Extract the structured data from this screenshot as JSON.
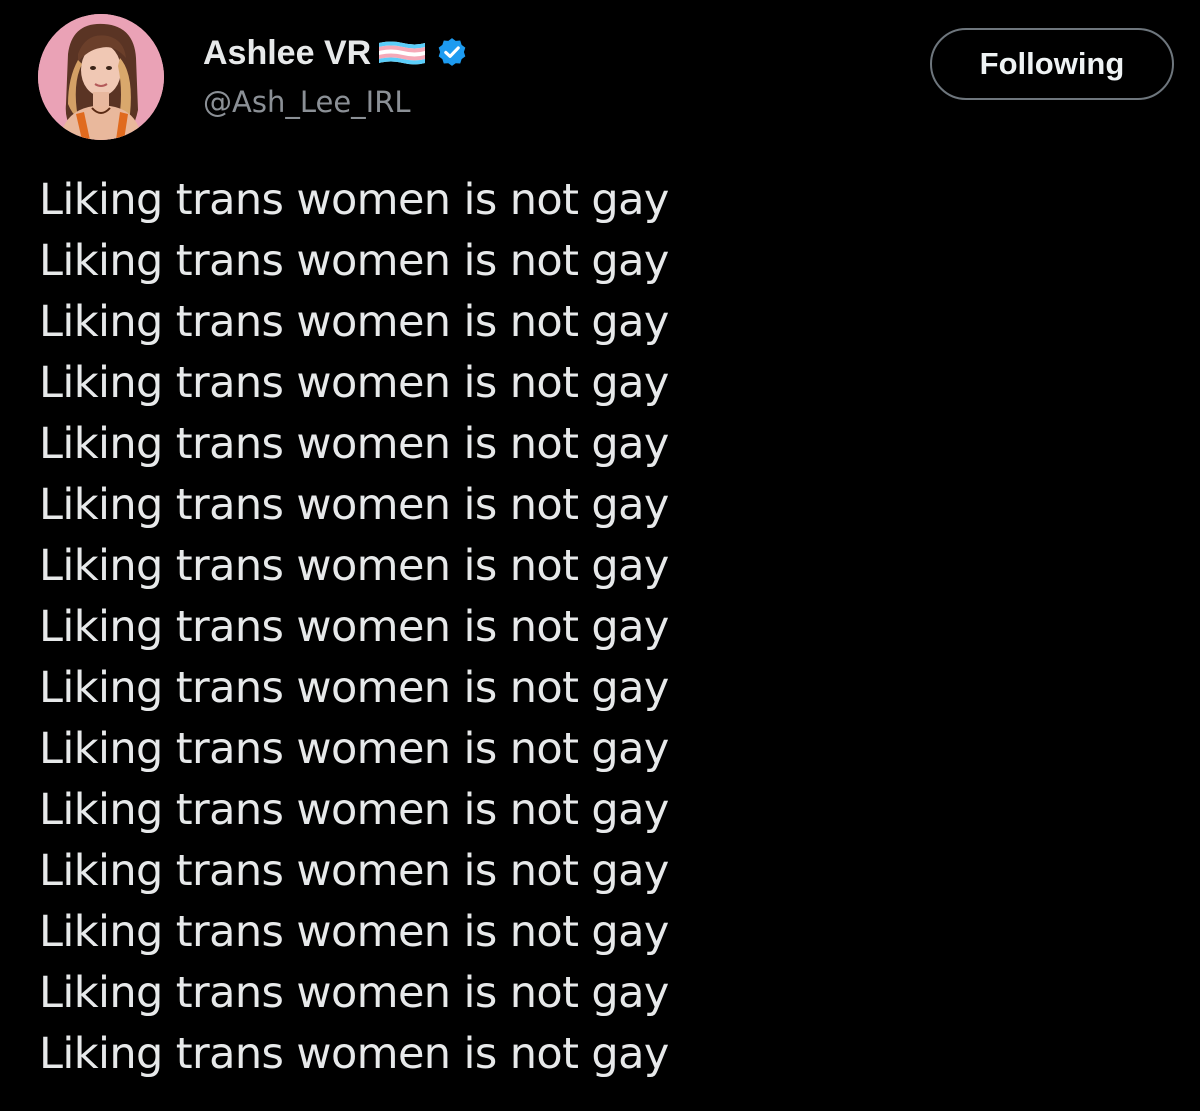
{
  "author": {
    "display_name": "Ashlee VR",
    "handle": "@Ash_Lee_IRL",
    "flag_icon": "transgender-flag-icon",
    "verified_icon": "verified-badge-icon",
    "verified_color": "#1d9bf0"
  },
  "follow_button": {
    "label": "Following"
  },
  "tweet": {
    "lines": [
      "Liking trans women is not gay",
      "Liking trans women is not gay",
      "Liking trans women is not gay",
      "Liking trans women is not gay",
      "Liking trans women is not gay",
      "Liking trans women is not gay",
      "Liking trans women is not gay",
      "Liking trans women is not gay",
      "Liking trans women is not gay",
      "Liking trans women is not gay",
      "Liking trans women is not gay",
      "Liking trans women is not gay",
      "Liking trans women is not gay",
      "Liking trans women is not gay",
      "Liking trans women is not gay"
    ]
  },
  "colors": {
    "background": "#000000",
    "text_primary": "#e7e9ea",
    "text_secondary": "#8b9096",
    "button_border": "#6e767d",
    "flag_blue": "#5bcefa",
    "flag_pink": "#f5a9b8",
    "flag_white": "#ffffff"
  }
}
